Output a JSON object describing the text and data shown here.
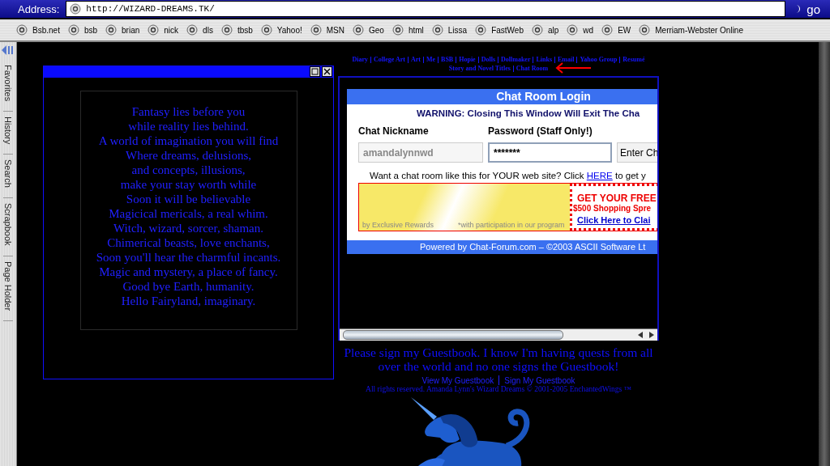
{
  "address_bar": {
    "label": "Address:",
    "url": "http://WIZARD-DREAMS.TK/",
    "go": "go"
  },
  "favorites": [
    "Bsb.net",
    "bsb",
    "brian",
    "nick",
    "dls",
    "tbsb",
    "Yahoo!",
    "MSN",
    "Geo",
    "html",
    "Lissa",
    "FastWeb",
    "alp",
    "wd",
    "EW",
    "Merriam-Webster Online"
  ],
  "sidebar_tabs": [
    "Favorites",
    "History",
    "Search",
    "Scrapbook",
    "Page Holder"
  ],
  "poem": [
    "Fantasy lies before you",
    "while reality lies behind.",
    "A world of imagination you will find",
    "Where dreams, delusions,",
    "and concepts, illusions,",
    "make your stay worth while",
    "Soon it will be believable",
    "Magicical mericals, a real whim.",
    "Witch, wizard, sorcer, shaman.",
    "Chimerical beasts, love enchants,",
    "Soon you'll hear the charmful incants.",
    "Magic and mystery, a place of fancy.",
    "Good bye Earth, humanity.",
    "Hello Fairyland, imaginary."
  ],
  "nav": [
    [
      "Diary",
      "College Art",
      "Art",
      "Me",
      "BSB",
      "Hopie",
      "Dolls",
      "Dollmaker",
      "Links",
      "Email",
      "Yahoo Group",
      "Resumé"
    ],
    [
      "Story and Novel Titles",
      "Chat Room"
    ]
  ],
  "chat": {
    "title": "Chat Room Login",
    "warning": "WARNING: Closing This Window Will Exit The Cha",
    "nickname_label": "Chat Nickname",
    "password_label": "Password (Staff Only!)",
    "nickname_value": "amandalynnwd",
    "password_value": "*******",
    "enter_button": "Enter Ch",
    "promo": {
      "text": "Want a chat room like this for YOUR web site? Click",
      "link": "HERE",
      "after": "to get y"
    },
    "ad": {
      "by": "by Exclusive Rewards",
      "note": "*with participation in our program",
      "headline": "GET YOUR FREE",
      "offer": "$500 Shopping Spre",
      "link": "Click Here to Clai"
    },
    "footer": "Powered by Chat-Forum.com – ©2003 ASCII Software Lt"
  },
  "guestbook": {
    "message": "Please sign my Guestbook. I know I'm having quests from all over the world and no one signs the Guestbook!",
    "links": [
      "View My Guestbook",
      "Sign My Guestbook"
    ],
    "copyright": "All rights reserved. Amanda Lynn's Wizard Dreams © 2001-2005 EnchantedWings ™"
  }
}
